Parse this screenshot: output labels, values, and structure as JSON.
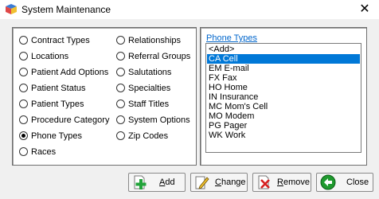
{
  "window": {
    "title": "System Maintenance",
    "close_glyph": "✕"
  },
  "options": [
    {
      "label": "Contract Types",
      "checked": false
    },
    {
      "label": "Locations",
      "checked": false
    },
    {
      "label": "Patient Add Options",
      "checked": false
    },
    {
      "label": "Patient Status",
      "checked": false
    },
    {
      "label": "Patient Types",
      "checked": false
    },
    {
      "label": "Procedure Category",
      "checked": false
    },
    {
      "label": "Phone Types",
      "checked": true
    },
    {
      "label": "Races",
      "checked": false
    },
    {
      "label": "Relationships",
      "checked": false
    },
    {
      "label": "Referral Groups",
      "checked": false
    },
    {
      "label": "Salutations",
      "checked": false
    },
    {
      "label": "Specialties",
      "checked": false
    },
    {
      "label": "Staff Titles",
      "checked": false
    },
    {
      "label": "System Options",
      "checked": false
    },
    {
      "label": "Zip Codes",
      "checked": false
    }
  ],
  "list": {
    "title": "Phone Types",
    "items": [
      "<Add>",
      "CA Cell",
      "EM E-mail",
      "FX Fax",
      "HO Home",
      "IN Insurance",
      "MC Mom's Cell",
      "MO Modem",
      "PG Pager",
      "WK Work"
    ],
    "selected_index": 1
  },
  "buttons": {
    "add": {
      "mnemonic": "A",
      "rest": "dd",
      "icon": "add-document-icon"
    },
    "change": {
      "mnemonic": "C",
      "rest": "hange",
      "icon": "edit-pencil-icon"
    },
    "remove": {
      "mnemonic": "R",
      "rest": "emove",
      "icon": "remove-document-icon"
    },
    "close": {
      "label": "Close",
      "icon": "back-arrow-icon"
    }
  },
  "colors": {
    "selection": "#0078d7",
    "list_title": "#0066cc",
    "add_icon": "#22a33a",
    "close_icon": "#1f9a2e",
    "remove_icon": "#d62020"
  }
}
